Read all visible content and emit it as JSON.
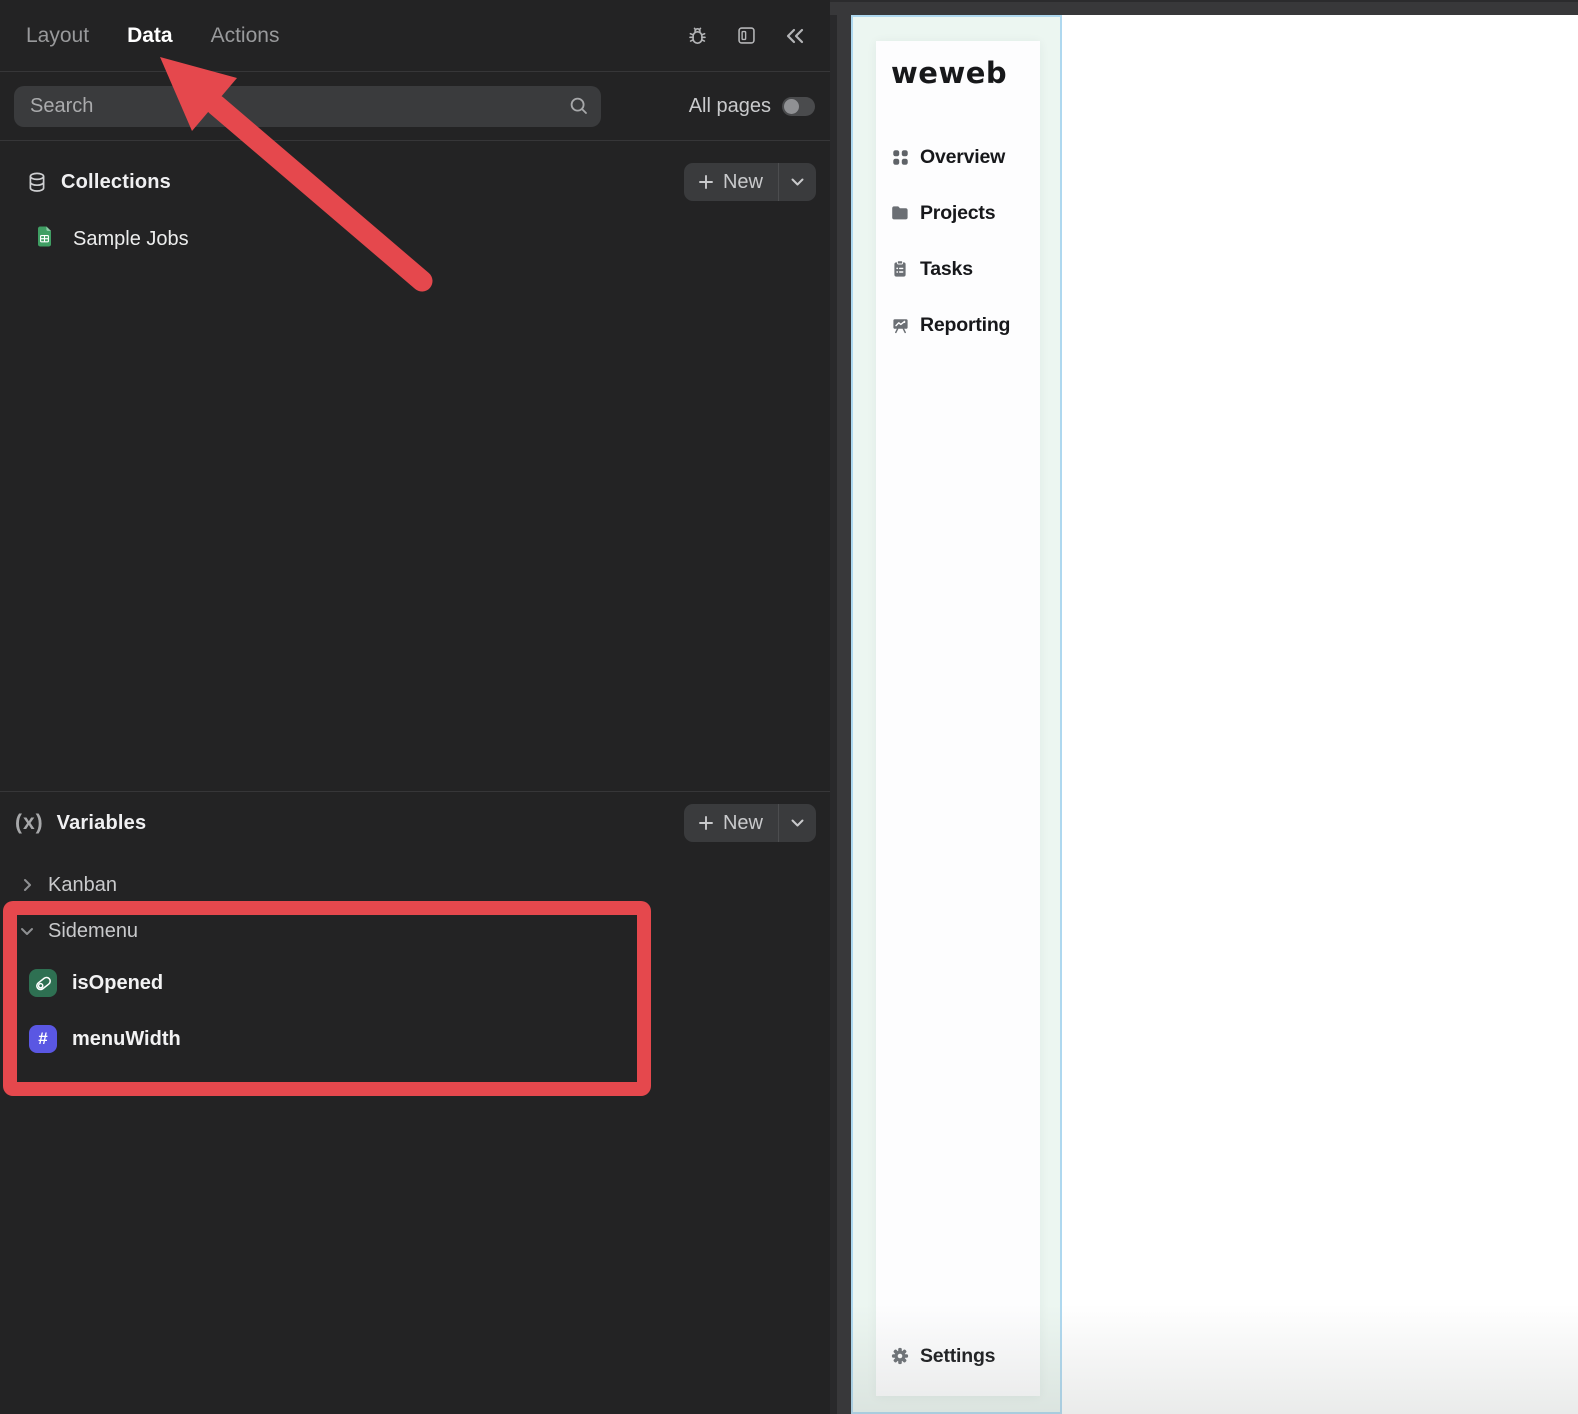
{
  "panel": {
    "tabs": {
      "layout": "Layout",
      "data": "Data",
      "actions": "Actions"
    },
    "search": {
      "placeholder": "Search"
    },
    "all_pages_label": "All pages",
    "collections": {
      "title": "Collections",
      "new_button": "New",
      "items": [
        {
          "label": "Sample Jobs"
        }
      ]
    },
    "variables": {
      "title": "Variables",
      "icon_glyph": "(x)",
      "new_button": "New",
      "groups": [
        {
          "label": "Kanban",
          "expanded": false
        },
        {
          "label": "Sidemenu",
          "expanded": true
        }
      ],
      "sidemenu_items": [
        {
          "name": "isOpened",
          "type": "boolean"
        },
        {
          "name": "menuWidth",
          "type": "number",
          "glyph": "#"
        }
      ]
    }
  },
  "canvas": {
    "logo_text": "weweb",
    "menu_items": [
      {
        "label": "Overview"
      },
      {
        "label": "Projects"
      },
      {
        "label": "Tasks"
      },
      {
        "label": "Reporting"
      }
    ],
    "settings_label": "Settings"
  },
  "colors": {
    "annotation_red": "#e5484d",
    "panel_background": "#232324",
    "boolean_chip": "#2e7052",
    "number_chip": "#5a57e3",
    "selection_background": "#ecf6f1",
    "selection_border": "#aed8ef"
  }
}
